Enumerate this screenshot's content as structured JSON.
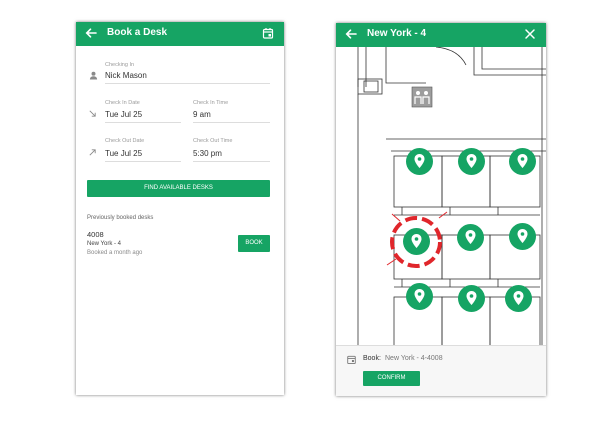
{
  "colors": {
    "accent": "#16a464",
    "alert": "#e0262b"
  },
  "booking": {
    "title": "Book a Desk",
    "checking_in_label": "Checking In",
    "checking_in_name": "Nick Mason",
    "check_in_date_label": "Check In Date",
    "check_in_date": "Tue Jul 25",
    "check_in_time_label": "Check In Time",
    "check_in_time": "9 am",
    "check_out_date_label": "Check Out Date",
    "check_out_date": "Tue Jul 25",
    "check_out_time_label": "Check Out Time",
    "check_out_time": "5:30 pm",
    "find_button": "FIND AVAILABLE DESKS",
    "previous_heading": "Previously booked desks",
    "previous": {
      "desk": "4008",
      "location": "New York - 4",
      "when": "Booked a month ago",
      "book_button": "BOOK"
    }
  },
  "map": {
    "title": "New York - 4",
    "book_label": "Book:",
    "book_value": "New York - 4-4008",
    "confirm_button": "CONFIRM",
    "pins": [
      {
        "icon": "location-pin-icon",
        "selected": false
      },
      {
        "icon": "location-pin-icon",
        "selected": false
      },
      {
        "icon": "location-pin-icon",
        "selected": false
      },
      {
        "icon": "location-pin-icon",
        "selected": true
      },
      {
        "icon": "location-pin-icon",
        "selected": false
      },
      {
        "icon": "location-pin-icon",
        "selected": false
      },
      {
        "icon": "location-pin-icon",
        "selected": false
      },
      {
        "icon": "location-pin-icon",
        "selected": false
      },
      {
        "icon": "location-pin-icon",
        "selected": false
      }
    ]
  }
}
